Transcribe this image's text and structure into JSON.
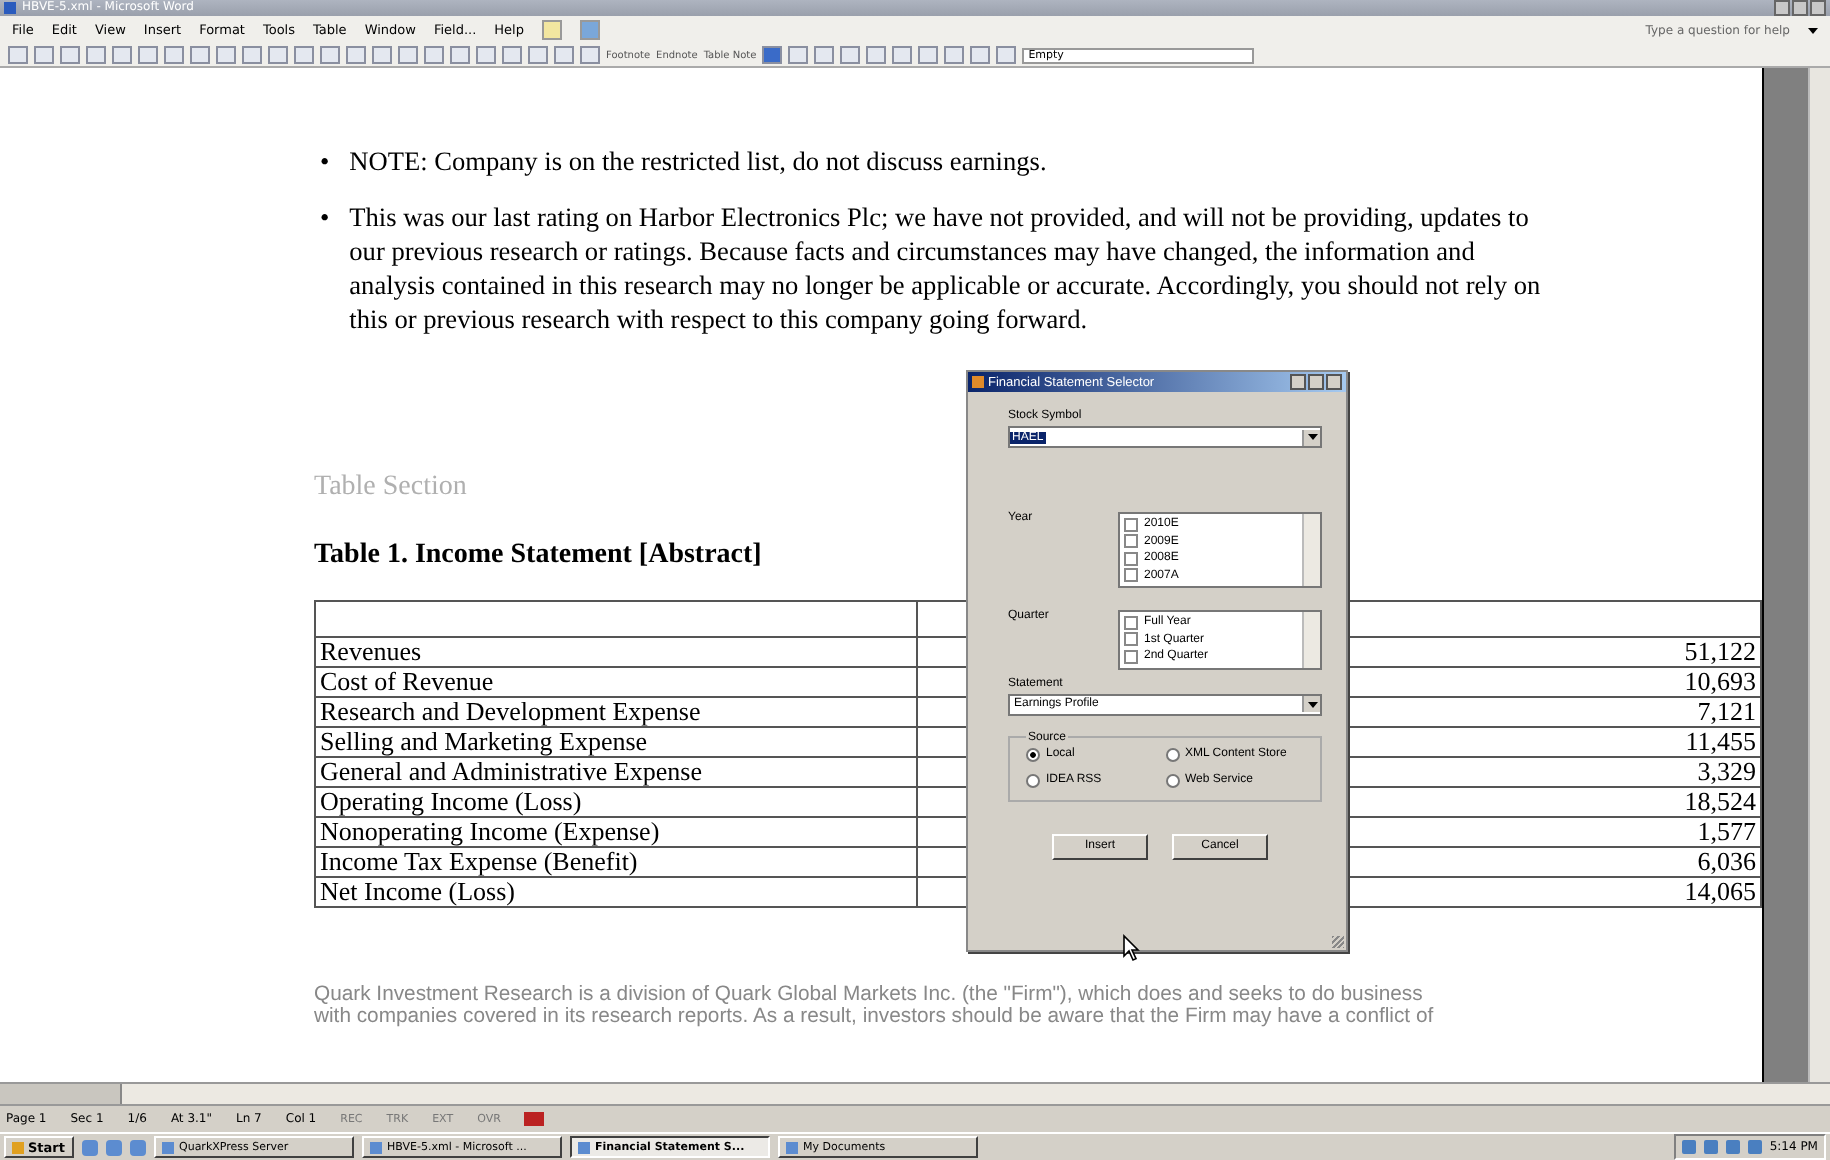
{
  "window": {
    "title": "HBVE-5.xml - Microsoft Word"
  },
  "menu": [
    "File",
    "Edit",
    "View",
    "Insert",
    "Format",
    "Tools",
    "Table",
    "Window",
    "Field...",
    "Help"
  ],
  "help_box": {
    "placeholder": "Type a question for help"
  },
  "toolbar": {
    "labels": [
      "Footnote",
      "Endnote",
      "Table Note"
    ],
    "style_box": "Empty"
  },
  "document": {
    "bullet_mark": "•",
    "bullets": [
      "NOTE: Company is on the restricted list, do not discuss earnings.",
      "This was our last rating on Harbor Electronics Plc; we have not provided, and will not be providing, updates to our previous research or ratings. Because facts and circumstances may have changed, the information and analysis contained in this research may no longer be applicable or accurate. Accordingly, you should not rely on this or previous research with respect to this company going forward."
    ],
    "section_label": "Table Section",
    "table_title": "Table 1. Income Statement [Abstract]",
    "table": {
      "rows": [
        {
          "label": "Revenues",
          "value": "51,122"
        },
        {
          "label": "Cost of Revenue",
          "value": "10,693"
        },
        {
          "label": "Research and Development Expense",
          "value": "7,121"
        },
        {
          "label": "Selling and Marketing Expense",
          "value": "11,455"
        },
        {
          "label": "General and Administrative Expense",
          "value": "3,329"
        },
        {
          "label": "Operating Income (Loss)",
          "value": "18,524"
        },
        {
          "label": "Nonoperating Income (Expense)",
          "value": "1,577"
        },
        {
          "label": "Income Tax Expense (Benefit)",
          "value": "6,036"
        },
        {
          "label": "Net Income (Loss)",
          "value": "14,065"
        }
      ]
    },
    "footer_lines": [
      "Quark Investment Research is a division of Quark Global Markets Inc. (the \"Firm\"), which does and seeks to do business",
      "with companies covered in its research reports. As a result, investors should be aware that the Firm may have a conflict of"
    ]
  },
  "dialog": {
    "title": "Financial Statement Selector",
    "stock_label": "Stock Symbol",
    "stock_value": "HAEL",
    "year_label": "Year",
    "years": [
      {
        "label": "2010E",
        "checked": false
      },
      {
        "label": "2009E",
        "checked": false
      },
      {
        "label": "2008E",
        "checked": false
      },
      {
        "label": "2007A",
        "checked": false
      }
    ],
    "quarter_label": "Quarter",
    "quarters": [
      {
        "label": "Full Year",
        "checked": false
      },
      {
        "label": "1st Quarter",
        "checked": false
      },
      {
        "label": "2nd Quarter",
        "checked": false
      }
    ],
    "statement_label": "Statement",
    "statement_value": "Earnings Profile",
    "source_label": "Source",
    "sources": [
      {
        "label": "Local",
        "selected": true
      },
      {
        "label": "XML Content Store",
        "selected": false
      },
      {
        "label": "IDEA RSS",
        "selected": false
      },
      {
        "label": "Web Service",
        "selected": false
      }
    ],
    "buttons": [
      "Insert",
      "Cancel"
    ]
  },
  "status_bar": {
    "items": [
      "Page 1",
      "Sec 1",
      "1/6",
      "At 3.1\"",
      "Ln 7",
      "Col 1"
    ],
    "modes": [
      {
        "label": "REC",
        "disabled": true
      },
      {
        "label": "TRK",
        "disabled": true
      },
      {
        "label": "EXT",
        "disabled": true
      },
      {
        "label": "OVR",
        "disabled": true
      }
    ]
  },
  "taskbar": {
    "start": "Start",
    "tasks": [
      {
        "label": "QuarkXPress Server",
        "selected": false
      },
      {
        "label": "HBVE-5.xml - Microsoft ...",
        "selected": false
      },
      {
        "label": "Financial Statement S...",
        "selected": true
      },
      {
        "label": "My Documents",
        "selected": false
      }
    ],
    "clock": "5:14 PM"
  }
}
